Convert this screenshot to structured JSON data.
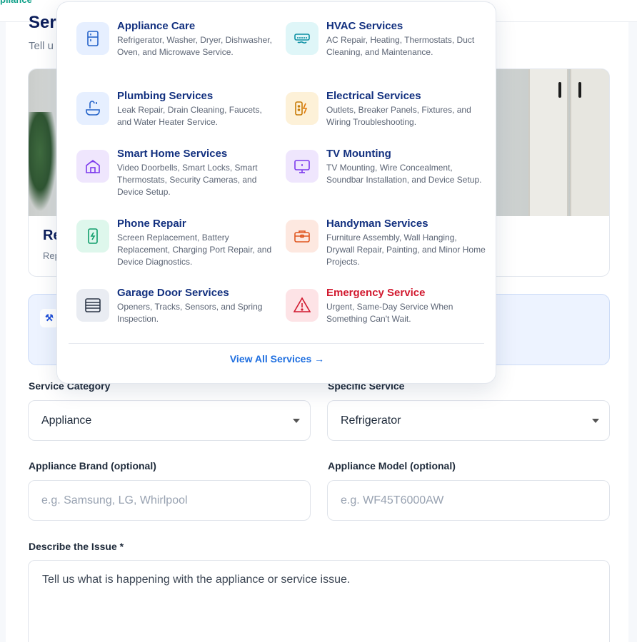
{
  "brand": {
    "logo_fragment": "pliance"
  },
  "section": {
    "title": "Ser",
    "subtitle": "Tell u"
  },
  "service_card": {
    "title": "Re",
    "description": "Rep"
  },
  "menu": {
    "items": [
      {
        "title": "Appliance Care",
        "description": "Refrigerator, Washer, Dryer, Dishwasher, Oven, and Microwave Service.",
        "icon": "refrigerator-icon",
        "color": "#e6efff"
      },
      {
        "title": "HVAC Services",
        "description": "AC Repair, Heating, Thermostats, Duct Cleaning, and Maintenance.",
        "icon": "air-conditioner-icon",
        "color": "#dff6f8"
      },
      {
        "title": "Plumbing Services",
        "description": "Leak Repair, Drain Cleaning, Faucets, and Water Heater Service.",
        "icon": "faucet-icon",
        "color": "#e6efff"
      },
      {
        "title": "Electrical Services",
        "description": "Outlets, Breaker Panels, Fixtures, and Wiring Troubleshooting.",
        "icon": "electrical-outlet-icon",
        "color": "#fdf1d8"
      },
      {
        "title": "Smart Home Services",
        "description": "Video Doorbells, Smart Locks, Smart Thermostats, Security Cameras, and Device Setup.",
        "icon": "smart-home-icon",
        "color": "#efe6fd"
      },
      {
        "title": "TV Mounting",
        "description": "TV Mounting, Wire Concealment, Soundbar Installation, and Device Setup.",
        "icon": "tv-icon",
        "color": "#efe6fd"
      },
      {
        "title": "Phone Repair",
        "description": "Screen Replacement, Battery Replacement, Charging Port Repair, and Device Diagnostics.",
        "icon": "phone-repair-icon",
        "color": "#def7ec"
      },
      {
        "title": "Handyman Services",
        "description": "Furniture Assembly, Wall Hanging, Drywall Repair, Painting, and Minor Home Projects.",
        "icon": "toolbox-icon",
        "color": "#fde8e0"
      },
      {
        "title": "Garage Door Services",
        "description": "Openers, Tracks, Sensors, and Spring Inspection.",
        "icon": "garage-door-icon",
        "color": "#e9ecf2"
      },
      {
        "title": "Emergency Service",
        "description": "Urgent, Same-Day Service When Something Can't Wait.",
        "icon": "warning-icon",
        "color": "#fde3e6"
      }
    ],
    "view_all": "View All Services →"
  },
  "form": {
    "service_category": {
      "label": "Service Category",
      "value": "Appliance"
    },
    "specific_service": {
      "label": "Specific Service",
      "value": "Refrigerator"
    },
    "brand": {
      "label": "Appliance Brand (optional)",
      "placeholder": "e.g. Samsung, LG, Whirlpool"
    },
    "model": {
      "label": "Appliance Model (optional)",
      "placeholder": "e.g. WF45T6000AW"
    },
    "issue": {
      "label": "Describe the Issue *",
      "placeholder": "Tell us what is happening with the appliance or service issue."
    }
  }
}
